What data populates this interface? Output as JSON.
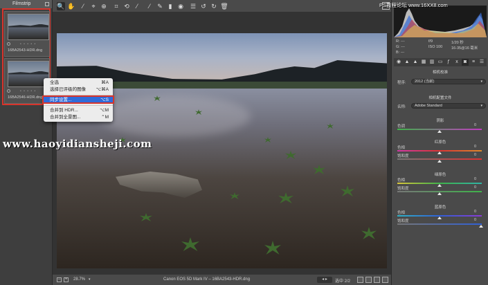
{
  "filmstrip": {
    "title": "Filmstrip",
    "items": [
      {
        "stars": "• • • • •",
        "filename": "16BA2543-HDR.dng"
      },
      {
        "stars": "• • • • •",
        "filename": "16BA2546-HDR.dng"
      }
    ]
  },
  "toolbar": {
    "tools": [
      "🔍",
      "✋",
      "⁄",
      "⌖",
      "⊕",
      "⌗",
      "⟲",
      "⁄",
      "⁄",
      "✎",
      "▮",
      "◉",
      "☰",
      "↺",
      "↻",
      "🗑"
    ]
  },
  "context_menu": {
    "items": [
      {
        "label": "全选",
        "shortcut": "⌘A"
      },
      {
        "label": "选择已评级的图像",
        "shortcut": "⌥⌘A"
      },
      {
        "label": "同步设置...",
        "shortcut": "⌥S",
        "highlighted": true
      },
      {
        "label": "合并到 HDR...",
        "shortcut": "⌥M"
      },
      {
        "label": "合并到全景图...",
        "shortcut": "⌃M"
      }
    ]
  },
  "watermarks": {
    "main": "www.haoyidiansheji.com",
    "corner": "PS教程论坛 www.16XX8.com"
  },
  "bottom_bar": {
    "zoom": "28.7%",
    "caption": "Canon EOS 5D Mark IV  –  16BA2543-HDR.dng",
    "selection": "选中 2/2"
  },
  "info": {
    "r": "R: ---",
    "g": "G: ---",
    "b": "B: ---",
    "aperture": "f/9",
    "shutter": "1/20 秒",
    "iso": "ISO 100",
    "lens": "16-35@16 毫米"
  },
  "panel": {
    "section_title": "相机校准",
    "process_label": "程序:",
    "process_value": "2012 (当前)",
    "profile_title": "相机配置文件",
    "name_label": "名称:",
    "name_value": "Adobe Standard",
    "shadows_title": "阴影",
    "tint_label": "色调",
    "tint_value": "0",
    "red_title": "红原色",
    "green_title": "绿原色",
    "blue_title": "蓝原色",
    "hue_label": "色相",
    "sat_label": "饱和度",
    "red_hue": "0",
    "red_sat": "0",
    "green_hue": "0",
    "green_sat": "0",
    "blue_hue": "0",
    "blue_sat": "0"
  },
  "colors": {
    "highlight_frame": "#d9342b",
    "menu_selection": "#2f6bd9"
  }
}
